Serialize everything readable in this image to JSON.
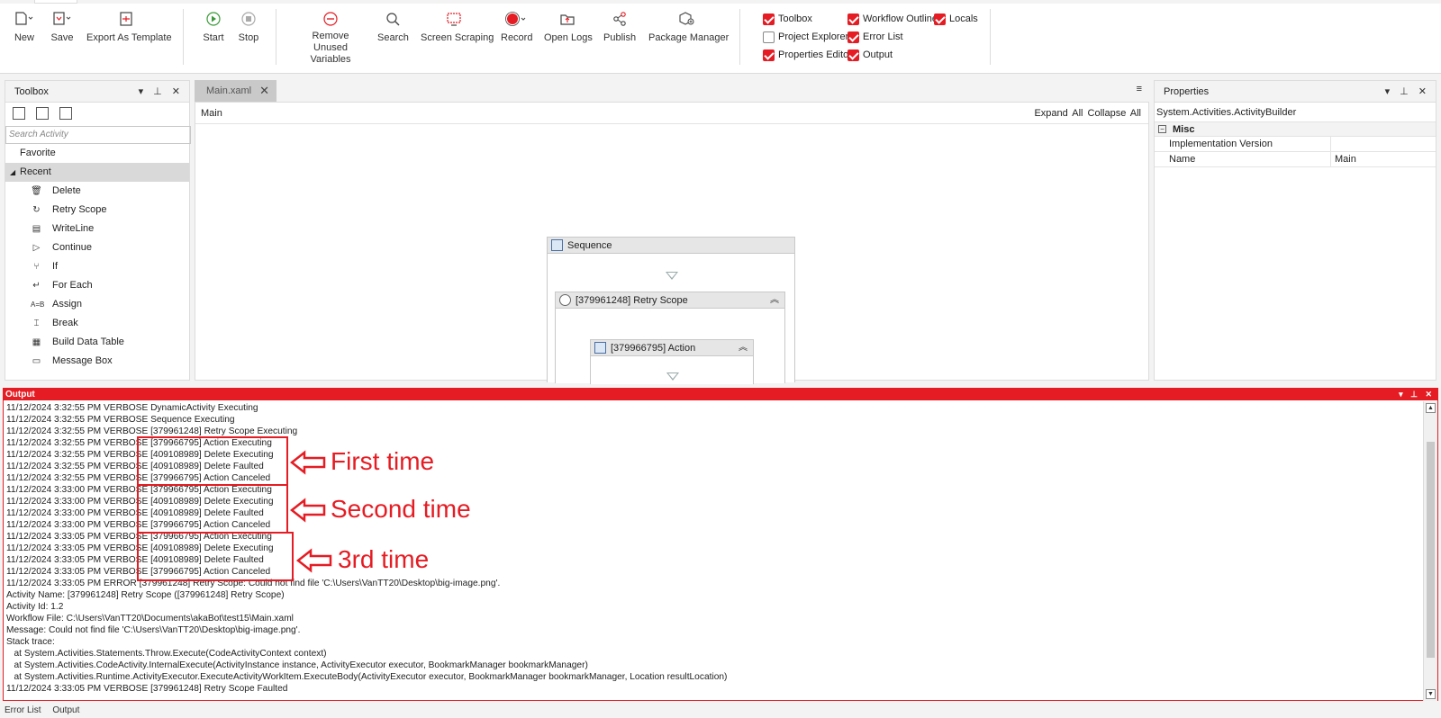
{
  "ribbon": {
    "buttons": [
      {
        "id": "new",
        "label": "New"
      },
      {
        "id": "save",
        "label": "Save"
      },
      {
        "id": "export",
        "label": "Export As Template"
      },
      {
        "id": "start",
        "label": "Start"
      },
      {
        "id": "stop",
        "label": "Stop"
      },
      {
        "id": "remove",
        "label": "Remove Unused Variables"
      },
      {
        "id": "search",
        "label": "Search"
      },
      {
        "id": "scraping",
        "label": "Screen Scraping"
      },
      {
        "id": "record",
        "label": "Record"
      },
      {
        "id": "logs",
        "label": "Open Logs"
      },
      {
        "id": "publish",
        "label": "Publish"
      },
      {
        "id": "package",
        "label": "Package Manager"
      }
    ],
    "checkboxes": [
      {
        "label": "Toolbox",
        "checked": true
      },
      {
        "label": "Workflow Outline",
        "checked": true
      },
      {
        "label": "Locals",
        "checked": true
      },
      {
        "label": "Project Explorer",
        "checked": false
      },
      {
        "label": "Error List",
        "checked": true
      },
      {
        "label": "Properties Editor",
        "checked": true
      },
      {
        "label": "Output",
        "checked": true
      }
    ]
  },
  "toolbox": {
    "title": "Toolbox",
    "search_placeholder": "Search Activity",
    "favorite": "Favorite",
    "recent": "Recent",
    "items": [
      "Delete",
      "Retry Scope",
      "WriteLine",
      "Continue",
      "If",
      "For Each",
      "Assign",
      "Break",
      "Build Data Table",
      "Message Box"
    ]
  },
  "designer": {
    "tab": "Main.xaml",
    "breadcrumb": "Main",
    "expand_all": "Expand All",
    "collapse_all": "Collapse All",
    "sequence": "Sequence",
    "retry_scope": "[379961248] Retry Scope",
    "action": "[379966795] Action"
  },
  "properties": {
    "title": "Properties",
    "object": "System.Activities.ActivityBuilder",
    "category": "Misc",
    "rows": [
      {
        "key": "Implementation Version",
        "value": ""
      },
      {
        "key": "Name",
        "value": "Main"
      }
    ]
  },
  "output": {
    "title": "Output",
    "lines": [
      "11/12/2024 3:32:55 PM VERBOSE DynamicActivity Executing",
      "11/12/2024 3:32:55 PM VERBOSE Sequence Executing",
      "11/12/2024 3:32:55 PM VERBOSE [379961248] Retry Scope Executing",
      "11/12/2024 3:32:55 PM VERBOSE [379966795] Action Executing",
      "11/12/2024 3:32:55 PM VERBOSE [409108989] Delete Executing",
      "11/12/2024 3:32:55 PM VERBOSE [409108989] Delete Faulted",
      "11/12/2024 3:32:55 PM VERBOSE [379966795] Action Canceled",
      "11/12/2024 3:33:00 PM VERBOSE [379966795] Action Executing",
      "11/12/2024 3:33:00 PM VERBOSE [409108989] Delete Executing",
      "11/12/2024 3:33:00 PM VERBOSE [409108989] Delete Faulted",
      "11/12/2024 3:33:00 PM VERBOSE [379966795] Action Canceled",
      "11/12/2024 3:33:05 PM VERBOSE [379966795] Action Executing",
      "11/12/2024 3:33:05 PM VERBOSE [409108989] Delete Executing",
      "11/12/2024 3:33:05 PM VERBOSE [409108989] Delete Faulted",
      "11/12/2024 3:33:05 PM VERBOSE [379966795] Action Canceled",
      "11/12/2024 3:33:05 PM ERROR [379961248] Retry Scope: Could not find file 'C:\\Users\\VanTT20\\Desktop\\big-image.png'.",
      "Activity Name: [379961248] Retry Scope ([379961248] Retry Scope)",
      "Activity Id: 1.2",
      "Workflow File: C:\\Users\\VanTT20\\Documents\\akaBot\\test15\\Main.xaml",
      "Message: Could not find file 'C:\\Users\\VanTT20\\Desktop\\big-image.png'.",
      "Stack trace:",
      "   at System.Activities.Statements.Throw.Execute(CodeActivityContext context)",
      "   at System.Activities.CodeActivity.InternalExecute(ActivityInstance instance, ActivityExecutor executor, BookmarkManager bookmarkManager)",
      "   at System.Activities.Runtime.ActivityExecutor.ExecuteActivityWorkItem.ExecuteBody(ActivityExecutor executor, BookmarkManager bookmarkManager, Location resultLocation)",
      "11/12/2024 3:33:05 PM VERBOSE [379961248] Retry Scope Faulted"
    ],
    "annotations": [
      "First time",
      "Second time",
      "3rd time"
    ]
  },
  "statusbar": {
    "tabs": [
      "Error List",
      "Output"
    ]
  },
  "colors": {
    "accent": "#e51c23"
  }
}
